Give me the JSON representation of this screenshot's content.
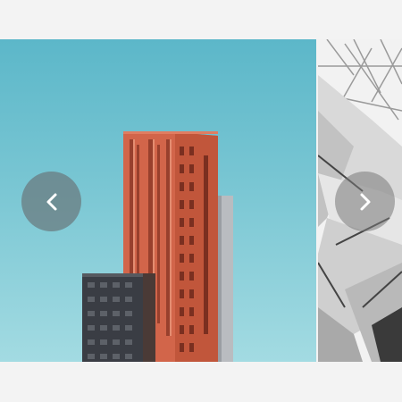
{
  "carousel": {
    "slides": [
      {
        "icon": "building-photo"
      },
      {
        "icon": "architecture-photo"
      }
    ],
    "prev_icon": "chevron-left-icon",
    "next_icon": "chevron-right-icon",
    "colors": {
      "background": "#f3f3f3",
      "sky_top": "#5cb7c9",
      "sky_bottom": "#a3dbe2",
      "tower": "#d96a4c",
      "dark_block": "#3b3e45",
      "nav_button": "#69787d"
    }
  }
}
